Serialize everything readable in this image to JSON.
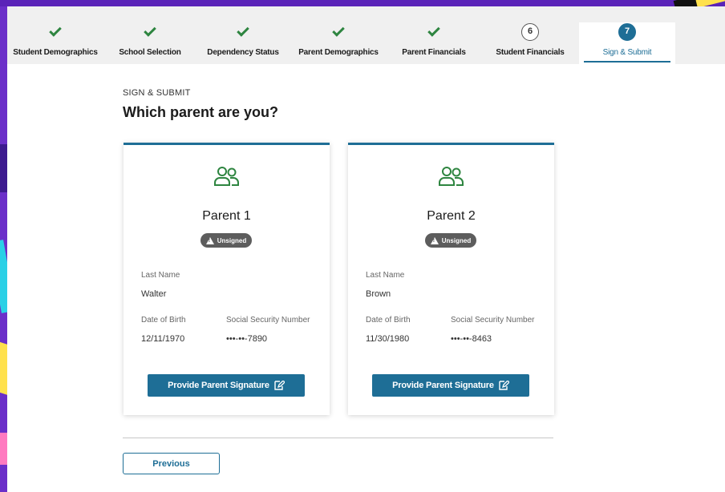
{
  "colors": {
    "accent": "#1e6e96",
    "success": "#2e8540",
    "badge": "#5d5d5d"
  },
  "steps": [
    {
      "label": "Student Demographics",
      "state": "complete"
    },
    {
      "label": "School Selection",
      "state": "complete"
    },
    {
      "label": "Dependency Status",
      "state": "complete"
    },
    {
      "label": "Parent Demographics",
      "state": "complete"
    },
    {
      "label": "Parent Financials",
      "state": "complete"
    },
    {
      "label": "Student Financials",
      "state": "pending",
      "number": "6"
    },
    {
      "label": "Sign & Submit",
      "state": "active",
      "number": "7"
    }
  ],
  "section": {
    "eyebrow": "SIGN & SUBMIT",
    "title": "Which parent are you?"
  },
  "parents": [
    {
      "title": "Parent 1",
      "status": "Unsigned",
      "last_name_label": "Last Name",
      "last_name": "Walter",
      "dob_label": "Date of Birth",
      "dob": "12/11/1970",
      "ssn_label": "Social Security Number",
      "ssn": "•••-••-7890",
      "button": "Provide Parent Signature"
    },
    {
      "title": "Parent 2",
      "status": "Unsigned",
      "last_name_label": "Last Name",
      "last_name": "Brown",
      "dob_label": "Date of Birth",
      "dob": "11/30/1980",
      "ssn_label": "Social Security Number",
      "ssn": "•••-••-8463",
      "button": "Provide Parent Signature"
    }
  ],
  "nav": {
    "previous": "Previous"
  }
}
